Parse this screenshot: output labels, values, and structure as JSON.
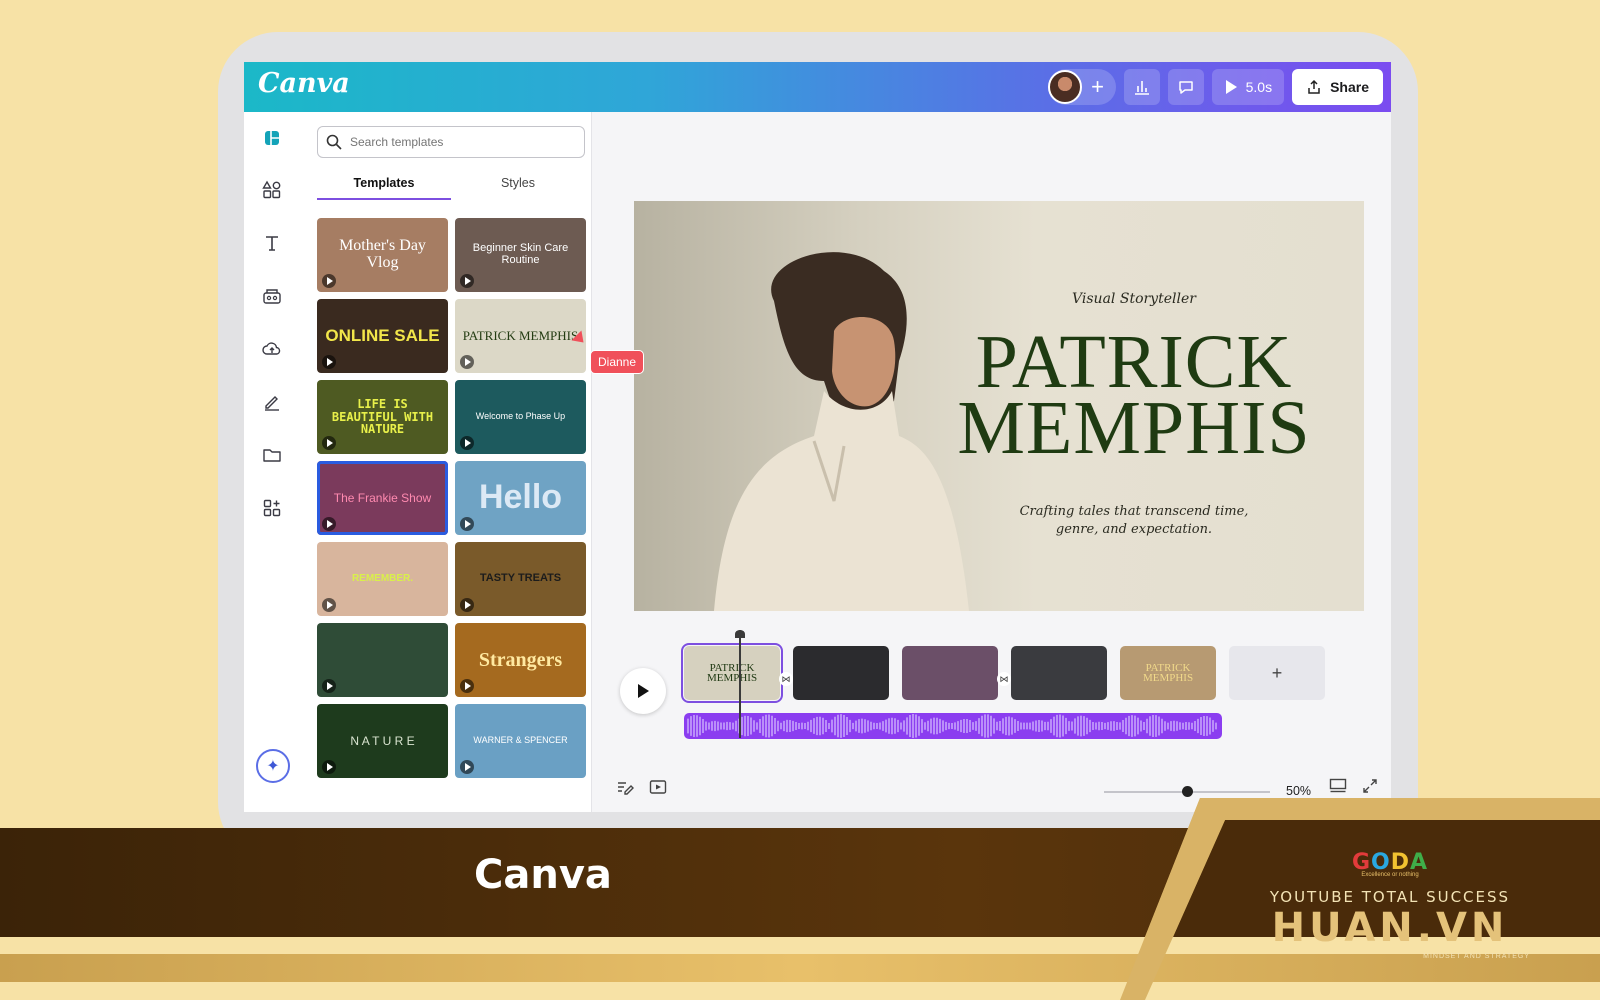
{
  "app": {
    "logo": "Canva",
    "accent": "#7d4fe0",
    "topbar_gradient": [
      "#1bb8c8",
      "#7b4cf0"
    ]
  },
  "toolbar": {
    "add_label": "+",
    "play_time": "5.0s",
    "share_label": "Share"
  },
  "rail": {
    "icons": [
      "design-icon",
      "elements-icon",
      "text-icon",
      "brand-icon",
      "uploads-icon",
      "draw-icon",
      "projects-icon",
      "apps-icon",
      "magic-icon"
    ]
  },
  "panel": {
    "search_placeholder": "Search templates",
    "tabs": [
      {
        "label": "Templates",
        "active": true
      },
      {
        "label": "Styles",
        "active": false
      }
    ],
    "templates": [
      {
        "label": "Mother's Day Vlog",
        "bg": "#a67d63",
        "fg": "#ffffff"
      },
      {
        "label": "Beginner Skin Care Routine",
        "bg": "#6d5b52",
        "fg": "#ffffff"
      },
      {
        "label": "ONLINE SALE",
        "bg": "#3a2a1f",
        "fg": "#f2e64a"
      },
      {
        "label": "PATRICK MEMPHIS",
        "bg": "#dcd8c7",
        "fg": "#233c12"
      },
      {
        "label": "LIFE IS BEAUTIFUL WITH NATURE",
        "bg": "#4e5a22",
        "fg": "#e8f04a"
      },
      {
        "label": "Welcome to Phase Up",
        "bg": "#1d5a5e",
        "fg": "#ffffff"
      },
      {
        "label": "The Frankie Show",
        "bg": "#7b3a5c",
        "fg": "#ff8ab0"
      },
      {
        "label": "Hello",
        "bg": "#6fa3c4",
        "fg": "#dce9f5"
      },
      {
        "label": "REMEMBER.",
        "bg": "#d8b59d",
        "fg": "#d9f04a"
      },
      {
        "label": "TASTY TREATS",
        "bg": "#7a5a2a",
        "fg": "#1c1c1c"
      },
      {
        "label": "",
        "bg": "#2f4c37",
        "fg": "#f6a5b6"
      },
      {
        "label": "Strangers",
        "bg": "#a56a1f",
        "fg": "#ffe9a0"
      },
      {
        "label": "N A T U R E",
        "bg": "#1e3b1d",
        "fg": "#d9e4d0"
      },
      {
        "label": "WARNER & SPENCER",
        "bg": "#6aa0c4",
        "fg": "#ffffff"
      }
    ]
  },
  "collaborator": {
    "name": "Dianne",
    "color": "#f0505a"
  },
  "slide": {
    "kicker": "Visual Storyteller",
    "name_line1": "PATRICK",
    "name_line2": "MEMPHIS",
    "tagline_line1": "Crafting tales that transcend time,",
    "tagline_line2": "genre, and expectation."
  },
  "timeline": {
    "clips": [
      {
        "label_line1": "PATRICK",
        "label_line2": "MEMPHIS",
        "bg": "#d6d1bf",
        "active": true
      },
      {
        "label_line1": "",
        "label_line2": "",
        "bg": "#2b2b2e",
        "active": false
      },
      {
        "label_line1": "",
        "label_line2": "",
        "bg": "#6b4f68",
        "active": false
      },
      {
        "label_line1": "",
        "label_line2": "",
        "bg": "#3a3b3f",
        "active": false
      },
      {
        "label_line1": "PATRICK MEMPHIS",
        "label_line2": "",
        "bg": "#b79a72",
        "active": false
      }
    ],
    "add_label": "+",
    "audio_color": "#8b3df0"
  },
  "footer": {
    "zoom": "50%",
    "zoom_level": 0.5
  },
  "banner": {
    "title": "Canva",
    "goda": "GODA",
    "goda_sub": "Excellence or nothing",
    "tagline": "YOUTUBE TOTAL SUCCESS",
    "brand": "HUAN.VN",
    "brand_sub": "MINDSET AND STRATEGY"
  }
}
